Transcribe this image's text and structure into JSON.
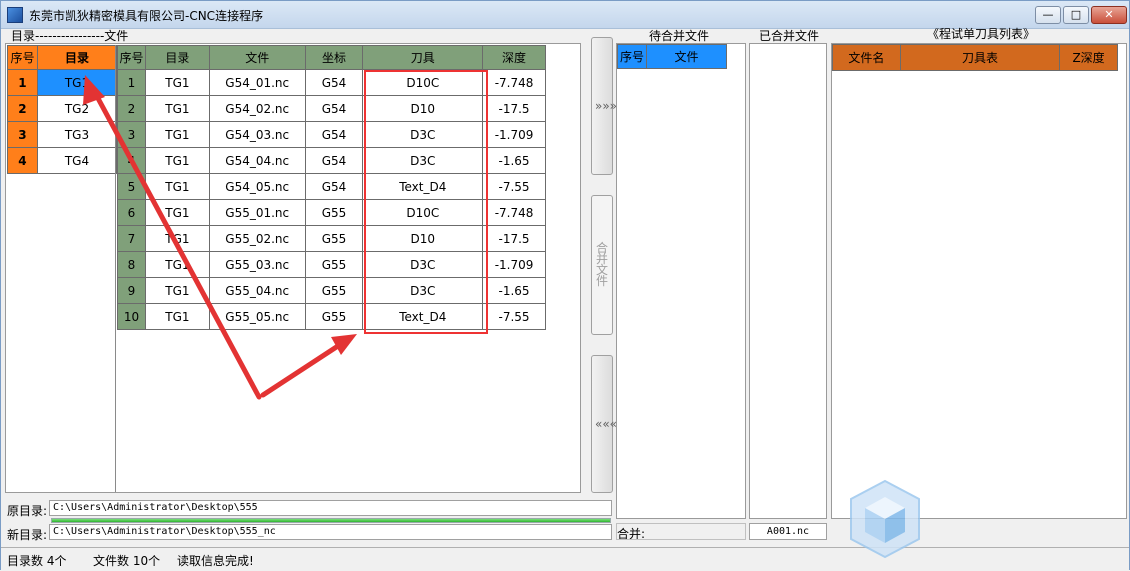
{
  "window": {
    "title": "东莞市凯狄精密模具有限公司-CNC连接程序",
    "min": "—",
    "max": "□",
    "close": "✕"
  },
  "labels": {
    "top_left": "目录----------------文件",
    "pending": "待合并文件",
    "merged": "已合并文件",
    "tool_list": "《程试单刀具列表》",
    "source_dir": "原目录:",
    "new_dir": "新目录:",
    "merge": "合并:"
  },
  "dir_table": {
    "headers": [
      "序号",
      "目录"
    ],
    "rows": [
      {
        "idx": "1",
        "name": "TG1"
      },
      {
        "idx": "2",
        "name": "TG2"
      },
      {
        "idx": "3",
        "name": "TG3"
      },
      {
        "idx": "4",
        "name": "TG4"
      }
    ]
  },
  "file_table": {
    "headers": [
      "序号",
      "目录",
      "文件",
      "坐标",
      "刀具",
      "深度"
    ],
    "rows": [
      {
        "idx": "1",
        "dir": "TG1",
        "file": "G54_01.nc",
        "coord": "G54",
        "tool": "D10C",
        "depth": "-7.748"
      },
      {
        "idx": "2",
        "dir": "TG1",
        "file": "G54_02.nc",
        "coord": "G54",
        "tool": "D10",
        "depth": "-17.5"
      },
      {
        "idx": "3",
        "dir": "TG1",
        "file": "G54_03.nc",
        "coord": "G54",
        "tool": "D3C",
        "depth": "-1.709"
      },
      {
        "idx": "4",
        "dir": "TG1",
        "file": "G54_04.nc",
        "coord": "G54",
        "tool": "D3C",
        "depth": "-1.65"
      },
      {
        "idx": "5",
        "dir": "TG1",
        "file": "G54_05.nc",
        "coord": "G54",
        "tool": "Text_D4",
        "depth": "-7.55"
      },
      {
        "idx": "6",
        "dir": "TG1",
        "file": "G55_01.nc",
        "coord": "G55",
        "tool": "D10C",
        "depth": "-7.748"
      },
      {
        "idx": "7",
        "dir": "TG1",
        "file": "G55_02.nc",
        "coord": "G55",
        "tool": "D10",
        "depth": "-17.5"
      },
      {
        "idx": "8",
        "dir": "TG1",
        "file": "G55_03.nc",
        "coord": "G55",
        "tool": "D3C",
        "depth": "-1.709"
      },
      {
        "idx": "9",
        "dir": "TG1",
        "file": "G55_04.nc",
        "coord": "G55",
        "tool": "D3C",
        "depth": "-1.65"
      },
      {
        "idx": "10",
        "dir": "TG1",
        "file": "G55_05.nc",
        "coord": "G55",
        "tool": "Text_D4",
        "depth": "-7.55"
      }
    ]
  },
  "buttons": {
    "add": "»»»",
    "merge": "合并文件",
    "remove": "«««"
  },
  "pending_table": {
    "headers": [
      "序号",
      "文件"
    ]
  },
  "tool_table": {
    "headers": [
      "文件名",
      "刀具表",
      "Z深度"
    ]
  },
  "paths": {
    "source": "C:\\Users\\Administrator\\Desktop\\555",
    "target": "C:\\Users\\Administrator\\Desktop\\555_nc"
  },
  "merge_output": "A001.nc",
  "progress_fraction": 1.0,
  "status": {
    "dir_count": "目录数 4个",
    "file_count": "文件数 10个",
    "message": "读取信息完成!"
  },
  "colors": {
    "dir_header": "#ff7f1a",
    "file_header": "#80a07a",
    "selection": "#1e90ff",
    "tool_header": "#d2691e",
    "annotation": "#e33333"
  },
  "icons": {
    "watermark": "cube-logo-icon"
  }
}
